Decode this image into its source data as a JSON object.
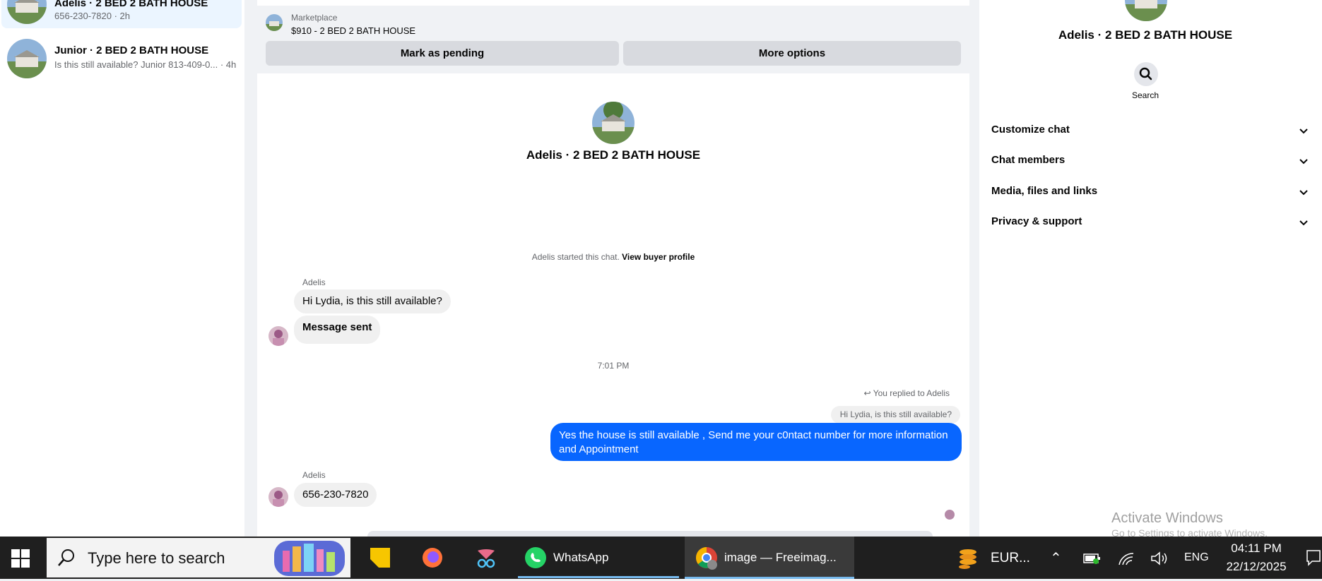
{
  "sidebar": {
    "conversations": [
      {
        "title": "Adelis · 2 BED 2 BATH HOUSE",
        "subtitle": "656-230-7820 · 2h"
      },
      {
        "title": "Junior · 2 BED 2 BATH HOUSE",
        "subtitle": "Is this still available? Junior 813-409-0... · 4h"
      }
    ]
  },
  "banner": {
    "label": "Marketplace",
    "listing": "$910 - 2 BED 2 BATH HOUSE",
    "pending_label": "Mark as pending",
    "more_label": "More options"
  },
  "chat": {
    "header_title": "Adelis · 2 BED 2 BATH HOUSE",
    "started_text": "Adelis started this chat.",
    "view_profile": "View buyer profile",
    "sender1": "Adelis",
    "msg1": "Hi Lydia, is this still available?",
    "msg2": "Message sent",
    "time": "7:01 PM",
    "reply_label": "You replied to Adelis",
    "quoted": "Hi Lydia, is this still available?",
    "out_line1": "Yes the house is still available , Send me your c0ntact number for more information",
    "out_line2": "and Appointment",
    "sender2": "Adelis",
    "msg3": "656-230-7820"
  },
  "right_panel": {
    "title": "Adelis · 2 BED 2 BATH HOUSE",
    "search_label": "Search",
    "sections": [
      "Customize chat",
      "Chat members",
      "Media, files and links",
      "Privacy & support"
    ]
  },
  "watermark": {
    "line1": "Activate Windows",
    "line2": "Go to Settings to activate Windows."
  },
  "taskbar": {
    "search_placeholder": "Type here to search",
    "whatsapp": "WhatsApp",
    "chrome": "image — Freeimag...",
    "currency": "EUR...",
    "lang": "ENG",
    "time": "04:11 PM",
    "date": "22/12/2025"
  },
  "colors": {
    "accent": "#0866ff",
    "bubble_in": "#f0f0f0",
    "taskbar": "#1f1f1f"
  }
}
